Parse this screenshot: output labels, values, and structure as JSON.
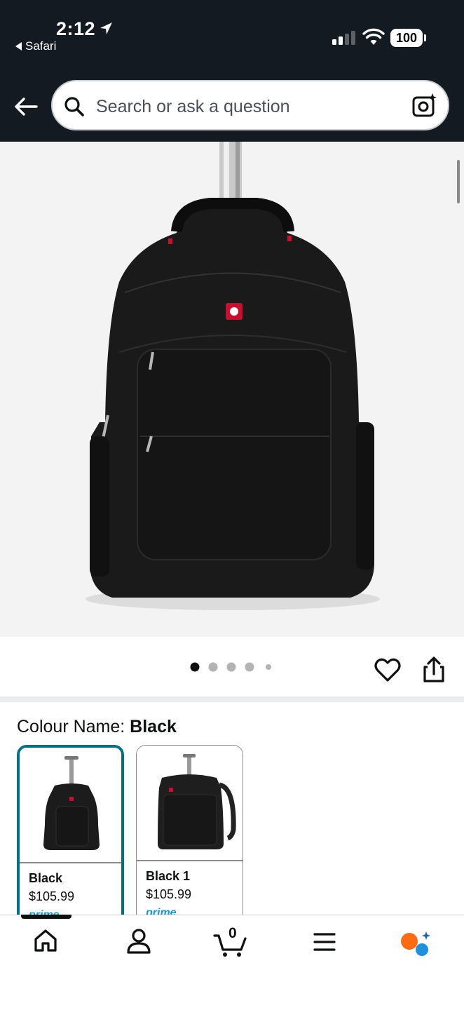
{
  "status_bar": {
    "time": "2:12",
    "back_app": "Safari",
    "battery": "100"
  },
  "header": {
    "search_placeholder": "Search or ask a question"
  },
  "gallery": {
    "image_count": 5,
    "active_index": 0
  },
  "variation": {
    "label": "Colour Name: ",
    "selected": "Black",
    "options": [
      {
        "name": "Black",
        "price": "$105.99",
        "badge": "prime",
        "selected": true
      },
      {
        "name": "Black 1",
        "price": "$105.99",
        "badge": "prime",
        "selected": false
      }
    ]
  },
  "bottom_nav": {
    "cart_count": "0",
    "items": [
      "home-icon",
      "account-icon",
      "cart-icon",
      "menu-icon",
      "rufus-assistant-icon"
    ]
  },
  "colors": {
    "header_bg": "#131a22",
    "selected_border": "#007185",
    "prime_blue": "#1399d6",
    "rufus_orange": "#ff6a13",
    "rufus_blue": "#1f8fe0"
  }
}
